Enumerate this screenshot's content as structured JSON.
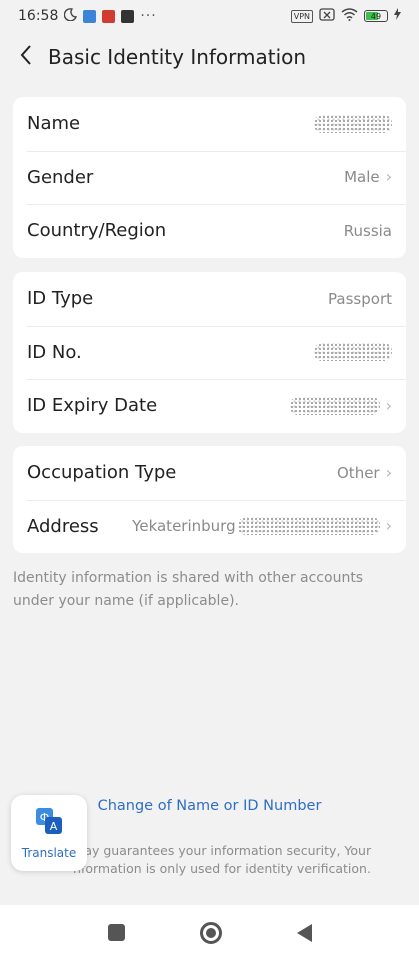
{
  "status_bar": {
    "time": "16:58",
    "left_icons": [
      "moon-icon",
      "telegram-icon",
      "yandex-icon",
      "app-icon"
    ],
    "overflow": "···",
    "vpn": "VPN",
    "battery": "49"
  },
  "header": {
    "back_icon": "chevron-left-icon",
    "title": "Basic Identity Information"
  },
  "card1": {
    "rows": [
      {
        "label": "Name",
        "value": ""
      },
      {
        "label": "Gender",
        "value": "Male"
      },
      {
        "label": "Country/Region",
        "value": "Russia"
      }
    ]
  },
  "card2": {
    "rows": [
      {
        "label": "ID Type",
        "value": "Passport"
      },
      {
        "label": "ID No.",
        "value": ""
      },
      {
        "label": "ID Expiry Date",
        "value": ""
      }
    ]
  },
  "card3": {
    "rows": [
      {
        "label": "Occupation Type",
        "value": "Other"
      },
      {
        "label": "Address",
        "value": "Yekaterinburg"
      }
    ]
  },
  "note": "Identity information is shared with other accounts under your name (if applicable).",
  "change_link": "Change of Name or ID Number",
  "footer": "ipay guarantees your information security, Your nformation is only used for identity verification.",
  "translate": {
    "label": "Translate",
    "icon": "translate-icon"
  },
  "nav": [
    "recents-icon",
    "home-icon",
    "back-icon"
  ],
  "colors": {
    "accent": "#2f6ec5",
    "background": "#f2f2f2"
  }
}
